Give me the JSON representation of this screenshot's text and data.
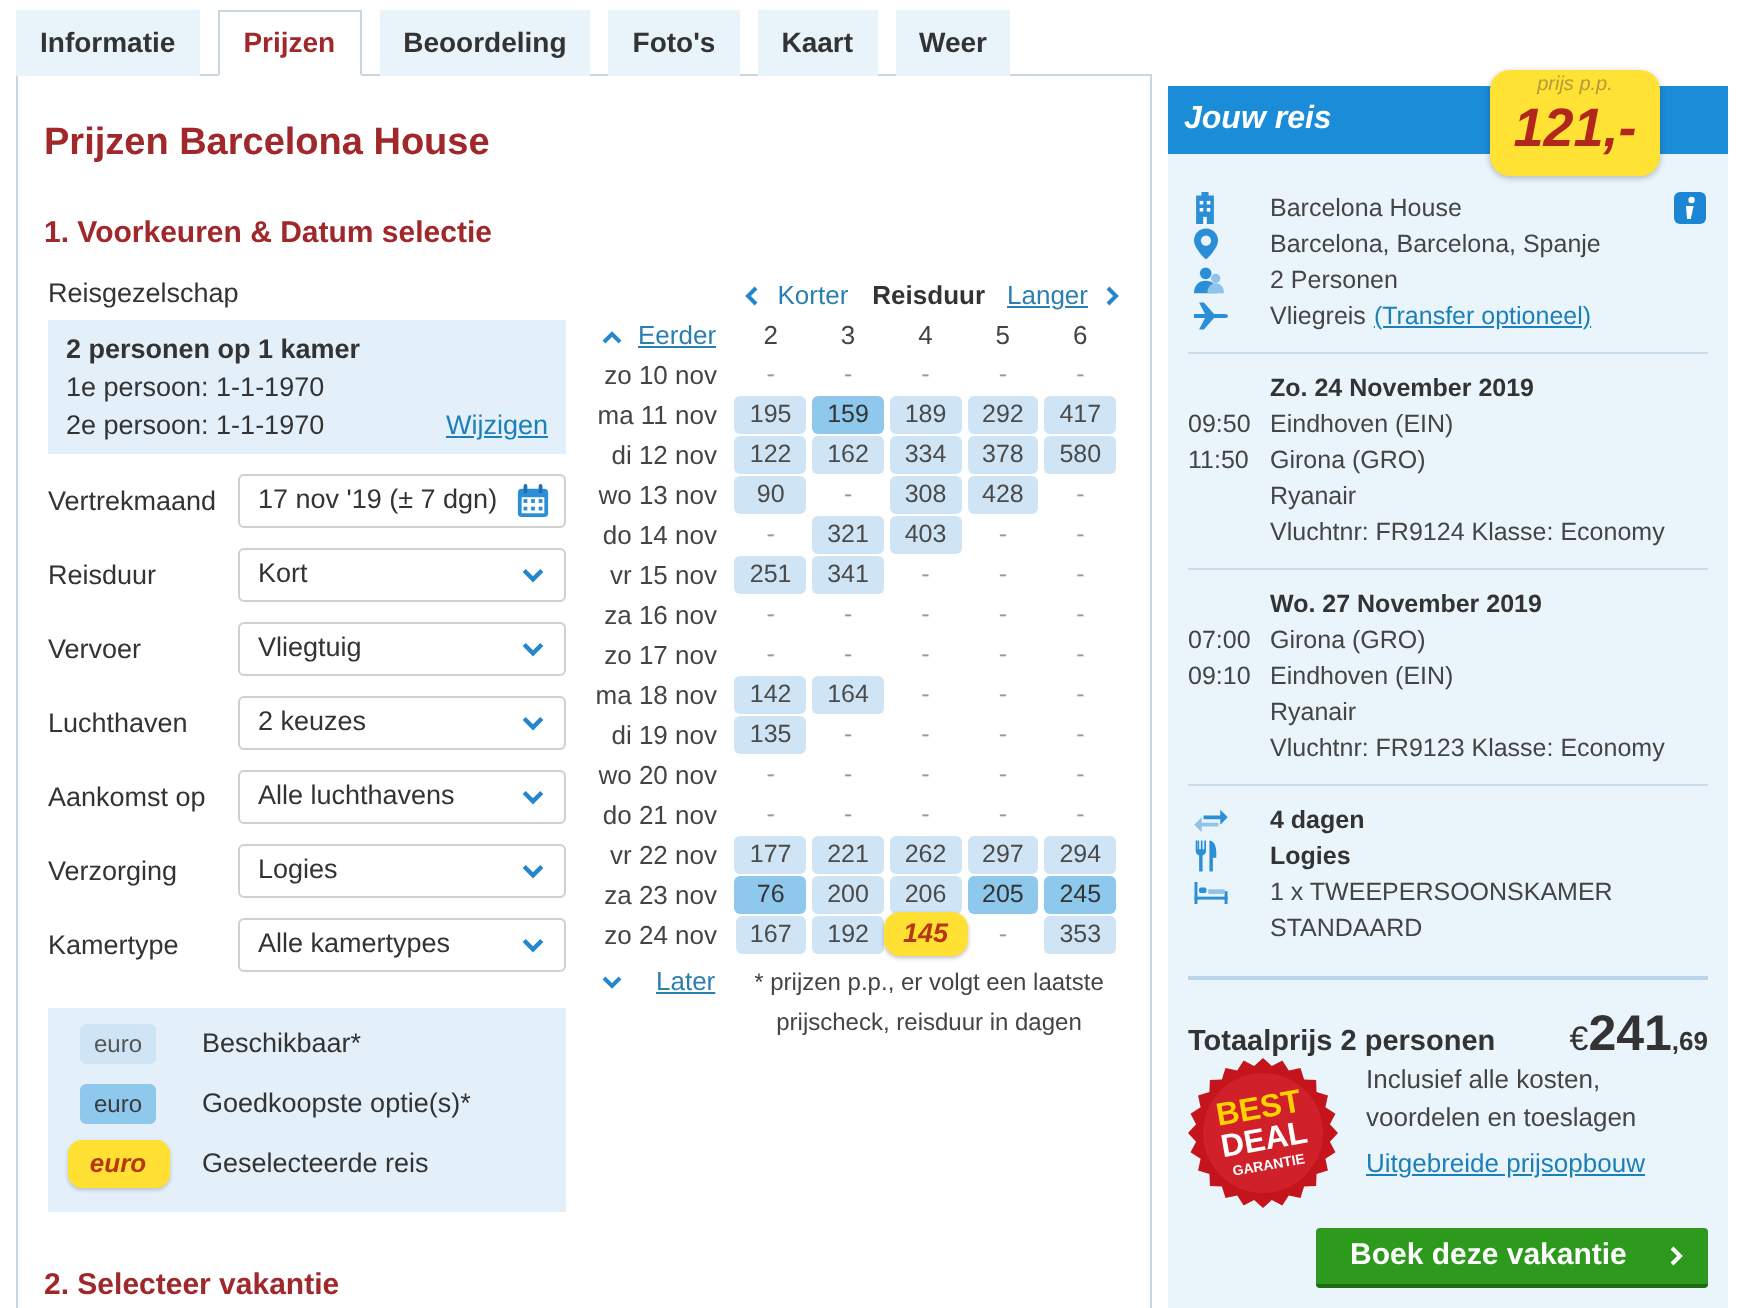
{
  "tabs": [
    {
      "label": "Informatie",
      "selected": false
    },
    {
      "label": "Prijzen",
      "selected": true
    },
    {
      "label": "Beoordeling",
      "selected": false
    },
    {
      "label": "Foto's",
      "selected": false
    },
    {
      "label": "Kaart",
      "selected": false
    },
    {
      "label": "Weer",
      "selected": false
    }
  ],
  "page_title": "Prijzen Barcelona House",
  "section_1": {
    "heading": "1. Voorkeuren & Datum selectie"
  },
  "travel_party": {
    "label": "Reisgezelschap",
    "summary": "2 personen op 1 kamer",
    "persons": [
      "1e persoon: 1-1-1970",
      "2e persoon: 1-1-1970"
    ],
    "edit_link": "Wijzigen"
  },
  "fields": [
    {
      "label": "Vertrekmaand",
      "value": "17 nov '19 (± 7 dgn)",
      "kind": "date"
    },
    {
      "label": "Reisduur",
      "value": "Kort",
      "kind": "select"
    },
    {
      "label": "Vervoer",
      "value": "Vliegtuig",
      "kind": "select"
    },
    {
      "label": "Luchthaven",
      "value": "2 keuzes",
      "kind": "select"
    },
    {
      "label": "Aankomst op",
      "value": "Alle luchthavens",
      "kind": "select"
    },
    {
      "label": "Verzorging",
      "value": "Logies",
      "kind": "select"
    },
    {
      "label": "Kamertype",
      "value": "Alle kamertypes",
      "kind": "select"
    }
  ],
  "legend": [
    {
      "sample": "euro",
      "label": "Beschikbaar*",
      "kind": "available"
    },
    {
      "sample": "euro",
      "label": "Goedkoopste optie(s)*",
      "kind": "cheapest"
    },
    {
      "sample": "euro",
      "label": "Geselecteerde reis",
      "kind": "selected"
    }
  ],
  "calendar": {
    "shorter": "Korter",
    "title": "Reisduur",
    "longer": "Langer",
    "earlier": "Eerder",
    "later": "Later",
    "durations": [
      "2",
      "3",
      "4",
      "5",
      "6"
    ],
    "rows": [
      {
        "date": "zo 10 nov",
        "cells": [
          {
            "price": "-",
            "kind": "unavailable",
            "selected": false
          },
          {
            "price": "-",
            "kind": "unavailable",
            "selected": false
          },
          {
            "price": "-",
            "kind": "unavailable",
            "selected": false
          },
          {
            "price": "-",
            "kind": "unavailable",
            "selected": false
          },
          {
            "price": "-",
            "kind": "unavailable",
            "selected": false
          }
        ]
      },
      {
        "date": "ma 11 nov",
        "cells": [
          {
            "price": "195",
            "kind": "available",
            "selected": false
          },
          {
            "price": "159",
            "kind": "cheapest",
            "selected": false
          },
          {
            "price": "189",
            "kind": "available",
            "selected": false
          },
          {
            "price": "292",
            "kind": "available",
            "selected": false
          },
          {
            "price": "417",
            "kind": "available",
            "selected": false
          }
        ]
      },
      {
        "date": "di 12 nov",
        "cells": [
          {
            "price": "122",
            "kind": "available",
            "selected": false
          },
          {
            "price": "162",
            "kind": "available",
            "selected": false
          },
          {
            "price": "334",
            "kind": "available",
            "selected": false
          },
          {
            "price": "378",
            "kind": "available",
            "selected": false
          },
          {
            "price": "580",
            "kind": "available",
            "selected": false
          }
        ]
      },
      {
        "date": "wo 13 nov",
        "cells": [
          {
            "price": "90",
            "kind": "available",
            "selected": false
          },
          {
            "price": "-",
            "kind": "unavailable",
            "selected": false
          },
          {
            "price": "308",
            "kind": "available",
            "selected": false
          },
          {
            "price": "428",
            "kind": "available",
            "selected": false
          },
          {
            "price": "-",
            "kind": "unavailable",
            "selected": false
          }
        ]
      },
      {
        "date": "do 14 nov",
        "cells": [
          {
            "price": "-",
            "kind": "unavailable",
            "selected": false
          },
          {
            "price": "321",
            "kind": "available",
            "selected": false
          },
          {
            "price": "403",
            "kind": "available",
            "selected": false
          },
          {
            "price": "-",
            "kind": "unavailable",
            "selected": false
          },
          {
            "price": "-",
            "kind": "unavailable",
            "selected": false
          }
        ]
      },
      {
        "date": "vr 15 nov",
        "cells": [
          {
            "price": "251",
            "kind": "available",
            "selected": false
          },
          {
            "price": "341",
            "kind": "available",
            "selected": false
          },
          {
            "price": "-",
            "kind": "unavailable",
            "selected": false
          },
          {
            "price": "-",
            "kind": "unavailable",
            "selected": false
          },
          {
            "price": "-",
            "kind": "unavailable",
            "selected": false
          }
        ]
      },
      {
        "date": "za 16 nov",
        "cells": [
          {
            "price": "-",
            "kind": "unavailable",
            "selected": false
          },
          {
            "price": "-",
            "kind": "unavailable",
            "selected": false
          },
          {
            "price": "-",
            "kind": "unavailable",
            "selected": false
          },
          {
            "price": "-",
            "kind": "unavailable",
            "selected": false
          },
          {
            "price": "-",
            "kind": "unavailable",
            "selected": false
          }
        ]
      },
      {
        "date": "zo 17 nov",
        "cells": [
          {
            "price": "-",
            "kind": "unavailable",
            "selected": false
          },
          {
            "price": "-",
            "kind": "unavailable",
            "selected": false
          },
          {
            "price": "-",
            "kind": "unavailable",
            "selected": false
          },
          {
            "price": "-",
            "kind": "unavailable",
            "selected": false
          },
          {
            "price": "-",
            "kind": "unavailable",
            "selected": false
          }
        ]
      },
      {
        "date": "ma 18 nov",
        "cells": [
          {
            "price": "142",
            "kind": "available",
            "selected": false
          },
          {
            "price": "164",
            "kind": "available",
            "selected": false
          },
          {
            "price": "-",
            "kind": "unavailable",
            "selected": false
          },
          {
            "price": "-",
            "kind": "unavailable",
            "selected": false
          },
          {
            "price": "-",
            "kind": "unavailable",
            "selected": false
          }
        ]
      },
      {
        "date": "di 19 nov",
        "cells": [
          {
            "price": "135",
            "kind": "available",
            "selected": false
          },
          {
            "price": "-",
            "kind": "unavailable",
            "selected": false
          },
          {
            "price": "-",
            "kind": "unavailable",
            "selected": false
          },
          {
            "price": "-",
            "kind": "unavailable",
            "selected": false
          },
          {
            "price": "-",
            "kind": "unavailable",
            "selected": false
          }
        ]
      },
      {
        "date": "wo 20 nov",
        "cells": [
          {
            "price": "-",
            "kind": "unavailable",
            "selected": false
          },
          {
            "price": "-",
            "kind": "unavailable",
            "selected": false
          },
          {
            "price": "-",
            "kind": "unavailable",
            "selected": false
          },
          {
            "price": "-",
            "kind": "unavailable",
            "selected": false
          },
          {
            "price": "-",
            "kind": "unavailable",
            "selected": false
          }
        ]
      },
      {
        "date": "do 21 nov",
        "cells": [
          {
            "price": "-",
            "kind": "unavailable",
            "selected": false
          },
          {
            "price": "-",
            "kind": "unavailable",
            "selected": false
          },
          {
            "price": "-",
            "kind": "unavailable",
            "selected": false
          },
          {
            "price": "-",
            "kind": "unavailable",
            "selected": false
          },
          {
            "price": "-",
            "kind": "unavailable",
            "selected": false
          }
        ]
      },
      {
        "date": "vr 22 nov",
        "cells": [
          {
            "price": "177",
            "kind": "available",
            "selected": false
          },
          {
            "price": "221",
            "kind": "available",
            "selected": false
          },
          {
            "price": "262",
            "kind": "available",
            "selected": false
          },
          {
            "price": "297",
            "kind": "available",
            "selected": false
          },
          {
            "price": "294",
            "kind": "available",
            "selected": false
          }
        ]
      },
      {
        "date": "za 23 nov",
        "cells": [
          {
            "price": "76",
            "kind": "cheapest",
            "selected": false
          },
          {
            "price": "200",
            "kind": "available",
            "selected": false
          },
          {
            "price": "206",
            "kind": "available",
            "selected": false
          },
          {
            "price": "205",
            "kind": "cheapest",
            "selected": false
          },
          {
            "price": "245",
            "kind": "cheapest",
            "selected": false
          }
        ]
      },
      {
        "date": "zo 24 nov",
        "cells": [
          {
            "price": "167",
            "kind": "available",
            "selected": false
          },
          {
            "price": "192",
            "kind": "available",
            "selected": false
          },
          {
            "price": "145",
            "selected": true
          },
          {
            "price": "-",
            "kind": "unavailable",
            "selected": false
          },
          {
            "price": "353",
            "kind": "available",
            "selected": false
          }
        ]
      }
    ],
    "note": "* prijzen p.p., er volgt een laatste prijscheck, reisduur in dagen"
  },
  "section_2": {
    "heading": "2. Selecteer vakantie"
  },
  "trip": {
    "title": "Jouw reis",
    "price_label": "prijs p.p.",
    "price": "121,-",
    "info": [
      {
        "kind": "hotel",
        "text": "Barcelona House"
      },
      {
        "kind": "location",
        "text": "Barcelona, Barcelona, Spanje"
      },
      {
        "kind": "persons",
        "text": "2 Personen"
      },
      {
        "kind": "transport",
        "text": "Vliegreis",
        "link": "(Transfer optioneel)"
      }
    ],
    "flights": [
      {
        "date": "Zo. 24 November 2019",
        "legs": [
          {
            "time": "09:50",
            "place": "Eindhoven (EIN)"
          },
          {
            "time": "11:50",
            "place": "Girona (GRO)"
          }
        ],
        "airline": "Ryanair",
        "details": "Vluchtnr: FR9124 Klasse: Economy"
      },
      {
        "date": "Wo. 27 November 2019",
        "legs": [
          {
            "time": "07:00",
            "place": "Girona (GRO)"
          },
          {
            "time": "09:10",
            "place": "Eindhoven (EIN)"
          }
        ],
        "airline": "Ryanair",
        "details": "Vluchtnr: FR9123 Klasse: Economy"
      }
    ],
    "stay": [
      {
        "kind": "duration",
        "text": "4 dagen"
      },
      {
        "kind": "board",
        "text": "Logies"
      },
      {
        "kind": "room",
        "text": "1 x TWEEPERSOONSKAMER STANDAARD"
      }
    ],
    "total": {
      "label": "Totaalprijs 2 personen",
      "currency": "€",
      "amount": "241",
      "cents": ",69"
    },
    "seal": [
      "BEST",
      "DEAL",
      "GARANTIE"
    ],
    "included": "Inclusief alle kosten, voordelen en toeslagen",
    "breakdown_link": "Uitgebreide prijsopbouw",
    "book_button": "Boek deze vakantie"
  }
}
